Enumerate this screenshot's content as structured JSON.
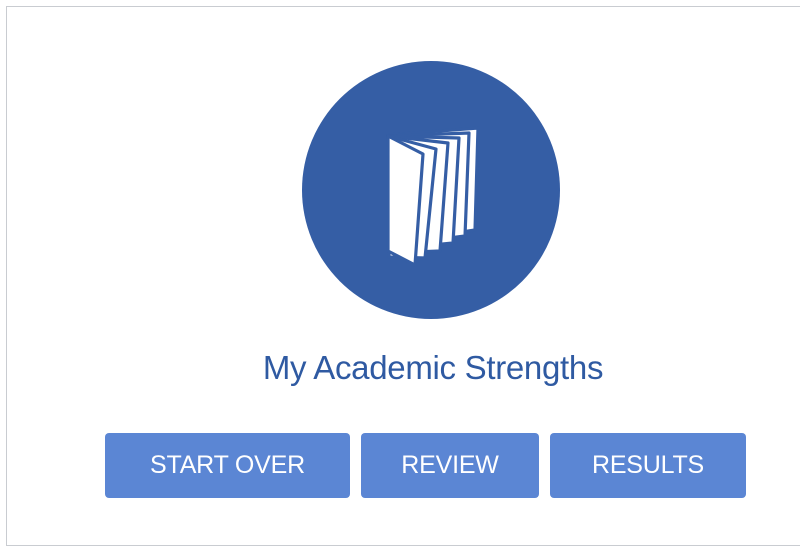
{
  "module": {
    "title": "My Academic Strengths",
    "icon": "open-book-icon",
    "accent_color": "#355ea5",
    "title_color": "#2f5aa2",
    "button_color": "#5b86d4"
  },
  "actions": {
    "start_over": "START OVER",
    "review": "REVIEW",
    "results": "RESULTS"
  }
}
